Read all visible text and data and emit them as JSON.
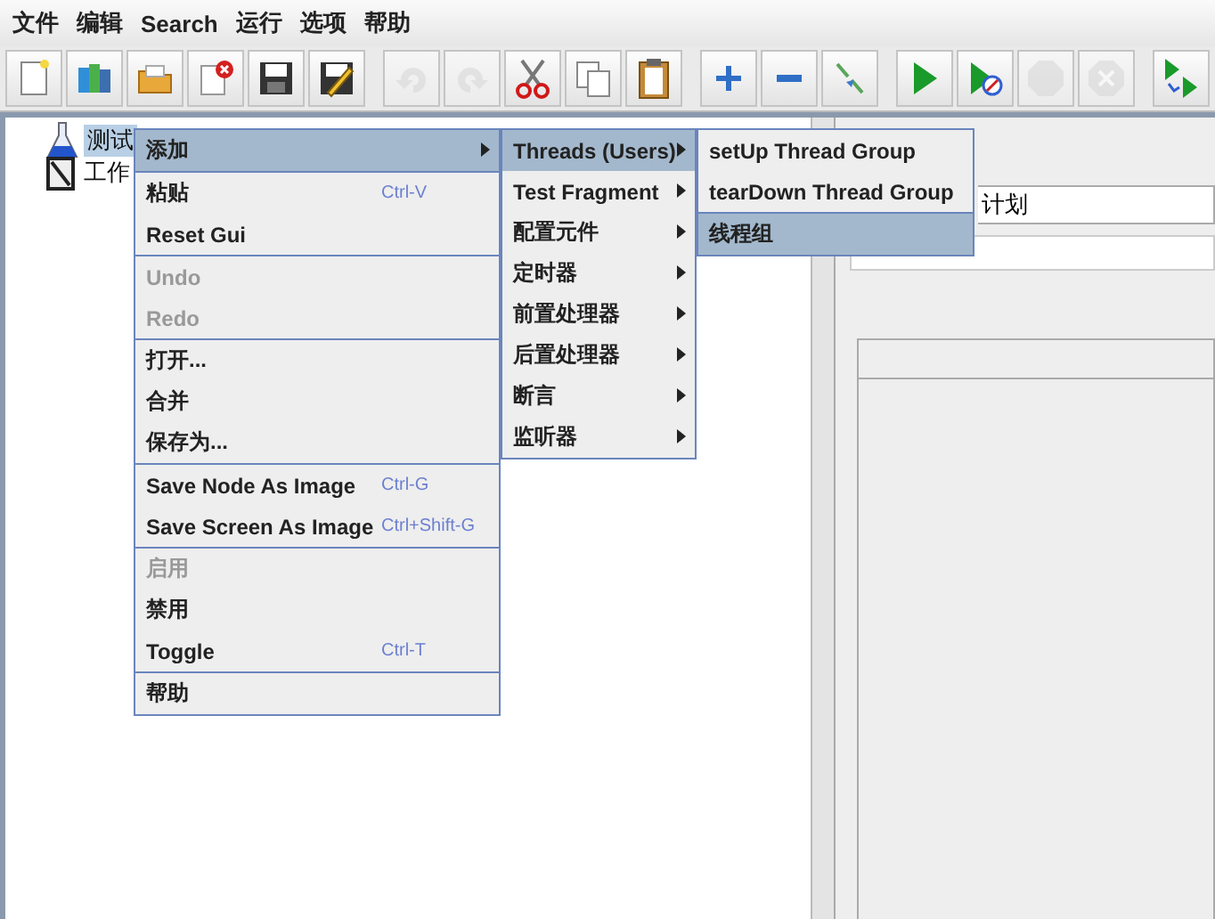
{
  "menubar": [
    "文件",
    "编辑",
    "Search",
    "运行",
    "选项",
    "帮助"
  ],
  "toolbar": [
    [
      {
        "kind": "new",
        "disabled": false
      },
      {
        "kind": "templates",
        "disabled": false
      },
      {
        "kind": "open",
        "disabled": false
      },
      {
        "kind": "close",
        "disabled": false
      },
      {
        "kind": "save",
        "disabled": false
      },
      {
        "kind": "edit",
        "disabled": false
      }
    ],
    [
      {
        "kind": "undo",
        "disabled": true
      },
      {
        "kind": "redo",
        "disabled": true
      },
      {
        "kind": "cut",
        "disabled": false
      },
      {
        "kind": "copy",
        "disabled": false
      },
      {
        "kind": "paste",
        "disabled": false
      }
    ],
    [
      {
        "kind": "expand",
        "disabled": false
      },
      {
        "kind": "collapse",
        "disabled": false
      },
      {
        "kind": "toggle",
        "disabled": false
      }
    ],
    [
      {
        "kind": "start",
        "disabled": false
      },
      {
        "kind": "start_no_pause",
        "disabled": false
      },
      {
        "kind": "stop",
        "disabled": true
      },
      {
        "kind": "shutdown",
        "disabled": true
      }
    ],
    [
      {
        "kind": "remote_start",
        "disabled": false
      }
    ]
  ],
  "tree": [
    {
      "label": "测试",
      "kind": "plan",
      "selected": true
    },
    {
      "label": "工作",
      "kind": "workbench",
      "selected": false
    }
  ],
  "context_menu": [
    [
      {
        "label": "添加",
        "disabled": false,
        "submenu": true,
        "selected": true
      }
    ],
    [
      {
        "label": "粘贴",
        "shortcut": "Ctrl-V",
        "disabled": false,
        "submenu": false,
        "selected": false
      },
      {
        "label": "Reset Gui",
        "disabled": false,
        "submenu": false,
        "selected": false
      }
    ],
    [
      {
        "label": "Undo",
        "disabled": true,
        "submenu": false,
        "selected": false
      },
      {
        "label": "Redo",
        "disabled": true,
        "submenu": false,
        "selected": false
      }
    ],
    [
      {
        "label": "打开...",
        "disabled": false,
        "submenu": false,
        "selected": false
      },
      {
        "label": "合并",
        "disabled": false,
        "submenu": false,
        "selected": false
      },
      {
        "label": "保存为...",
        "disabled": false,
        "submenu": false,
        "selected": false
      }
    ],
    [
      {
        "label": "Save Node As Image",
        "shortcut": "Ctrl-G",
        "disabled": false,
        "submenu": false,
        "selected": false
      },
      {
        "label": "Save Screen As Image",
        "shortcut": "Ctrl+Shift-G",
        "disabled": false,
        "submenu": false,
        "selected": false
      }
    ],
    [
      {
        "label": "启用",
        "disabled": true,
        "submenu": false,
        "selected": false
      },
      {
        "label": "禁用",
        "disabled": false,
        "submenu": false,
        "selected": false
      },
      {
        "label": "Toggle",
        "shortcut": "Ctrl-T",
        "disabled": false,
        "submenu": false,
        "selected": false
      }
    ],
    [
      {
        "label": "帮助",
        "disabled": false,
        "submenu": false,
        "selected": false
      }
    ]
  ],
  "add_submenu": [
    {
      "label": "Threads (Users)",
      "selected": true
    },
    {
      "label": "Test Fragment",
      "selected": false
    },
    {
      "label": "配置元件",
      "selected": false
    },
    {
      "label": "定时器",
      "selected": false
    },
    {
      "label": "前置处理器",
      "selected": false
    },
    {
      "label": "后置处理器",
      "selected": false
    },
    {
      "label": "断言",
      "selected": false
    },
    {
      "label": "监听器",
      "selected": false
    }
  ],
  "threads_submenu": [
    [
      {
        "label": "setUp Thread Group",
        "selected": false
      },
      {
        "label": "tearDown Thread Group",
        "selected": false
      }
    ],
    [
      {
        "label": "线程组",
        "selected": true
      }
    ]
  ],
  "name_field": {
    "value": "计划"
  }
}
